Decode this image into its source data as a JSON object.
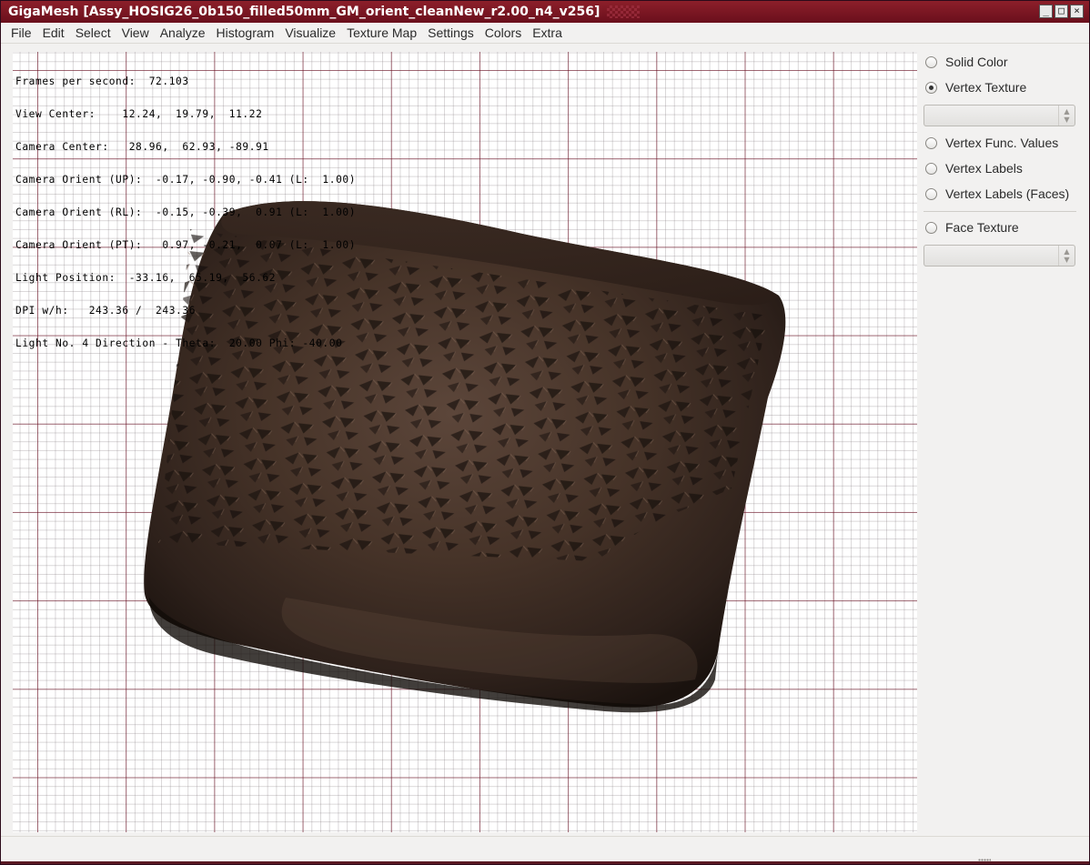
{
  "window": {
    "title": "GigaMesh [Assy_HOSIG26_0b150_filled50mm_GM_orient_cleanNew_r2.00_n4_v256]",
    "buttons": {
      "minimize": "_",
      "maximize": "□",
      "close": "×"
    }
  },
  "menubar": {
    "items": [
      "File",
      "Edit",
      "Select",
      "View",
      "Analyze",
      "Histogram",
      "Visualize",
      "Texture Map",
      "Settings",
      "Colors",
      "Extra"
    ]
  },
  "viewport": {
    "info_lines": [
      "Frames per second:  72.103",
      "View Center:    12.24,  19.79,  11.22",
      "Camera Center:   28.96,  62.93, -89.91",
      "Camera Orient (UP):  -0.17, -0.90, -0.41 (L:  1.00)",
      "Camera Orient (RL):  -0.15, -0.39,  0.91 (L:  1.00)",
      "Camera Orient (PT):   0.97, -0.21,  0.07 (L:  1.00)",
      "Light Position:  -33.16,  65.19,  56.62",
      "DPI w/h:   243.36 /  243.36",
      "Light No. 4 Direction - Theta:  20.00 Phi: -40.00"
    ],
    "colors": {
      "grid_major": "#6e0a1e",
      "tablet_dark": "#2a1c16",
      "tablet_light": "#6b5244"
    }
  },
  "side_panel": {
    "radios": {
      "solid_color": {
        "label": "Solid Color",
        "checked": false
      },
      "vertex_texture": {
        "label": "Vertex Texture",
        "checked": true
      },
      "vertex_func_values": {
        "label": "Vertex Func. Values",
        "checked": false
      },
      "vertex_labels": {
        "label": "Vertex Labels",
        "checked": false
      },
      "vertex_labels_faces": {
        "label": "Vertex Labels (Faces)",
        "checked": false
      },
      "face_texture": {
        "label": "Face Texture",
        "checked": false
      }
    },
    "combo_vertex_texture": {
      "value": ""
    },
    "combo_face_texture": {
      "value": ""
    }
  }
}
